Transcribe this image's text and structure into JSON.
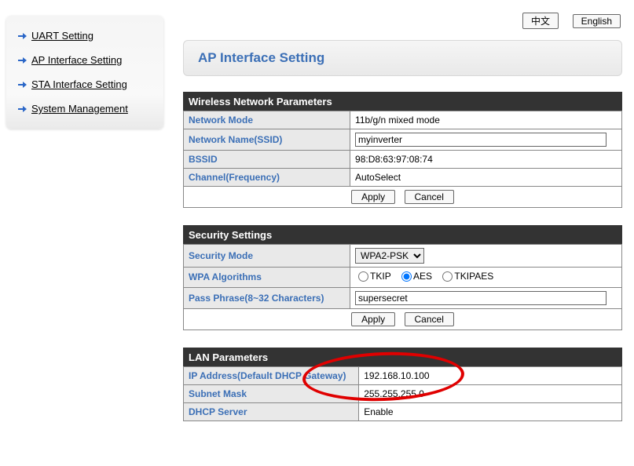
{
  "lang": {
    "chinese": "中文",
    "english": "English"
  },
  "sidebar": {
    "items": [
      {
        "label": "UART Setting"
      },
      {
        "label": "AP Interface Setting"
      },
      {
        "label": "STA Interface Setting"
      },
      {
        "label": "System Management"
      }
    ]
  },
  "page": {
    "title": "AP Interface Setting"
  },
  "wireless": {
    "header": "Wireless Network Parameters",
    "network_mode_label": "Network Mode",
    "network_mode_value": "11b/g/n mixed mode",
    "ssid_label": "Network Name(SSID)",
    "ssid_value": "myinverter",
    "bssid_label": "BSSID",
    "bssid_value": "98:D8:63:97:08:74",
    "channel_label": "Channel(Frequency)",
    "channel_value": "AutoSelect",
    "apply": "Apply",
    "cancel": "Cancel"
  },
  "security": {
    "header": "Security Settings",
    "mode_label": "Security Mode",
    "mode_value": "WPA2-PSK",
    "algo_label": "WPA Algorithms",
    "algo_tkip": "TKIP",
    "algo_aes": "AES",
    "algo_tkipaes": "TKIPAES",
    "pass_label": "Pass Phrase(8~32 Characters)",
    "pass_value": "supersecret",
    "apply": "Apply",
    "cancel": "Cancel"
  },
  "lan": {
    "header": "LAN Parameters",
    "ip_label": "IP Address(Default DHCP Gateway)",
    "ip_value": "192.168.10.100",
    "mask_label": "Subnet Mask",
    "mask_value": "255.255.255.0",
    "dhcp_label": "DHCP Server",
    "dhcp_value": "Enable"
  }
}
